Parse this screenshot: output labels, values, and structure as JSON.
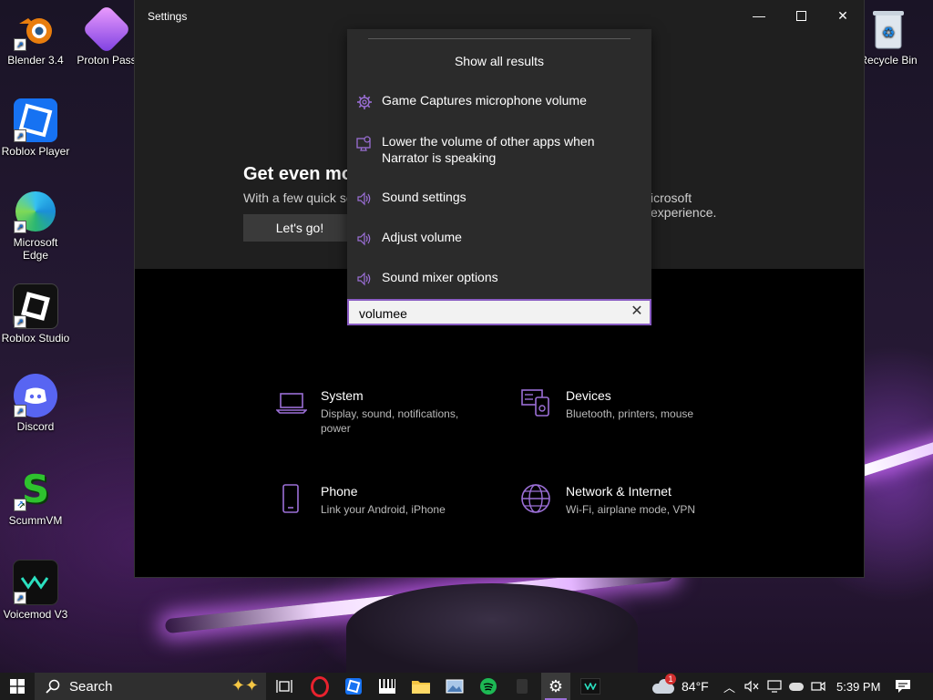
{
  "desktop": {
    "icons": [
      {
        "label": "Blender 3.4",
        "icon": "blender-icon"
      },
      {
        "label": "Proton Pass",
        "icon": "proton-pass-icon"
      },
      {
        "label": "Recycle Bin",
        "icon": "recycle-bin-icon"
      },
      {
        "label": "Roblox Player",
        "icon": "roblox-player-icon"
      },
      {
        "label": "Microsoft Edge",
        "icon": "edge-icon"
      },
      {
        "label": "Roblox Studio",
        "icon": "roblox-studio-icon"
      },
      {
        "label": "Discord",
        "icon": "discord-icon"
      },
      {
        "label": "ScummVM",
        "icon": "scummvm-icon"
      },
      {
        "label": "Voicemod V3",
        "icon": "voicemod-icon"
      }
    ]
  },
  "settings": {
    "window_title": "Settings",
    "hero": {
      "heading": "Get even mo",
      "subtitle_left": "With a few quick se",
      "subtitle_right": "icrosoft experience.",
      "cta": "Let's go!"
    },
    "categories": [
      {
        "title": "System",
        "desc": "Display, sound, notifications, power",
        "icon": "laptop-icon"
      },
      {
        "title": "Devices",
        "desc": "Bluetooth, printers, mouse",
        "icon": "keyboard-icon"
      },
      {
        "title": "Phone",
        "desc": "Link your Android, iPhone",
        "icon": "phone-icon"
      },
      {
        "title": "Network & Internet",
        "desc": "Wi-Fi, airplane mode, VPN",
        "icon": "globe-icon"
      }
    ],
    "search": {
      "value": "volumee",
      "show_all": "Show all results",
      "results": [
        {
          "label": "Game Captures microphone volume",
          "icon": "gear-icon"
        },
        {
          "label": "Lower the volume of other apps when Narrator is speaking",
          "icon": "narrator-icon"
        },
        {
          "label": "Sound settings",
          "icon": "speaker-icon"
        },
        {
          "label": "Adjust volume",
          "icon": "speaker-icon"
        },
        {
          "label": "Sound mixer options",
          "icon": "speaker-icon"
        }
      ]
    }
  },
  "taskbar": {
    "search_label": "Search",
    "temperature": "84°F",
    "time": "5:39 PM",
    "weather_badge": "1"
  },
  "colors": {
    "accent": "#8a5cc4",
    "icon_purple": "#9b6fd6"
  }
}
